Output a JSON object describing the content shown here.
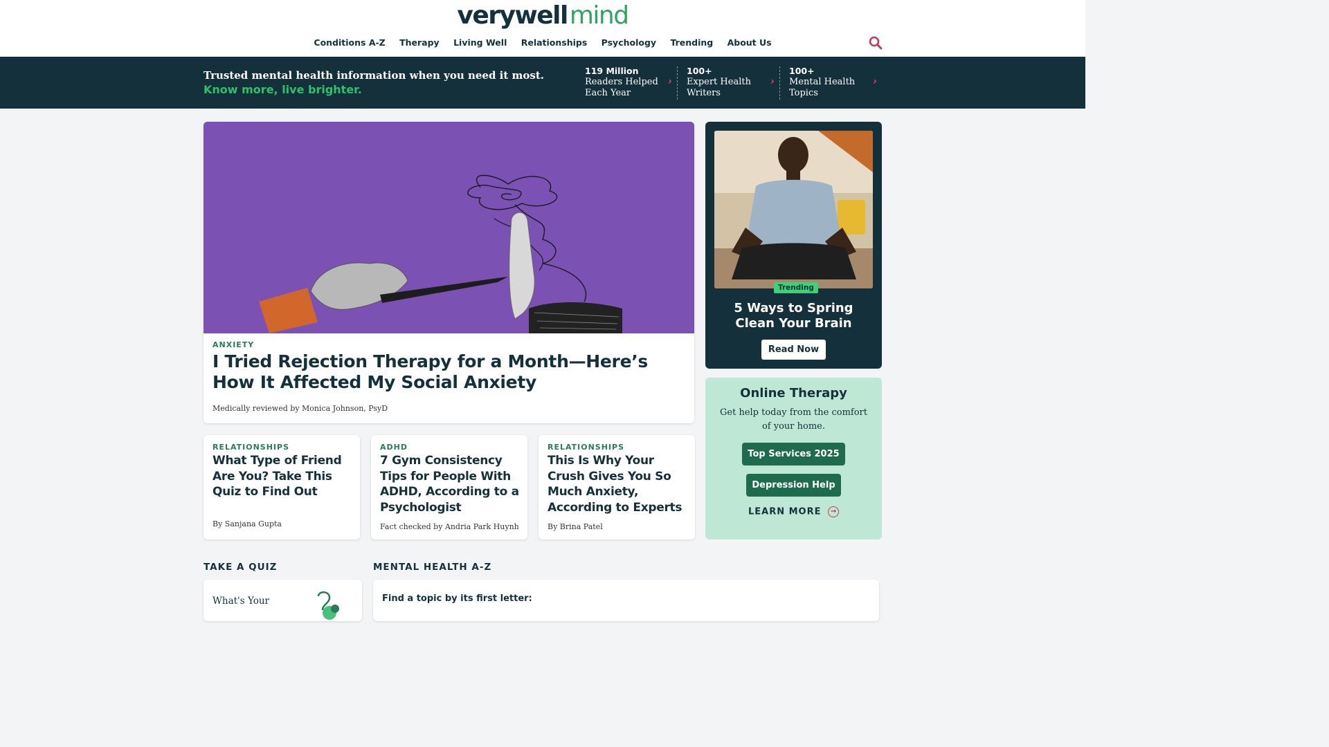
{
  "header": {
    "logo_main": "verywell",
    "logo_sub": "mind",
    "nav": [
      "Conditions A-Z",
      "Therapy",
      "Living Well",
      "Relationships",
      "Psychology",
      "Trending",
      "About Us"
    ]
  },
  "banner": {
    "line1": "Trusted mental health information when you need it most.",
    "line2": "Know more, live brighter.",
    "stats": [
      {
        "number": "119 Million",
        "line1": "Readers Helped",
        "line2": "Each Year"
      },
      {
        "number": "100+",
        "line1": "Expert Health",
        "line2": "Writers"
      },
      {
        "number": "100+",
        "line1": "Mental Health",
        "line2": "Topics"
      }
    ]
  },
  "hero": {
    "tag": "ANXIETY",
    "title": "I Tried Rejection Therapy for a Month—Here’s How It Affected My Social Anxiety",
    "byline": "Medically reviewed by Monica Johnson, PsyD"
  },
  "cards": [
    {
      "tag": "RELATIONSHIPS",
      "title": "What Type of Friend Are You? Take This Quiz to Find Out",
      "byline": "By Sanjana Gupta"
    },
    {
      "tag": "ADHD",
      "title": "7 Gym Consistency Tips for People With ADHD, According to a Psychologist",
      "byline": "Fact checked by Andria Park Huynh"
    },
    {
      "tag": "RELATIONSHIPS",
      "title": "This Is Why Your Crush Gives You So Much Anxiety, According to Experts",
      "byline": "By Brina Patel"
    }
  ],
  "trending": {
    "badge": "Trending",
    "title": "5 Ways to Spring Clean Your Brain",
    "button": "Read Now"
  },
  "therapy": {
    "title": "Online Therapy",
    "subtitle": "Get help today from the comfort of your home.",
    "button1": "Top Services 2025",
    "button2": "Depression Help",
    "learn_more": "LEARN MORE"
  },
  "quiz": {
    "heading": "TAKE A QUIZ",
    "text": "What's Your"
  },
  "az": {
    "heading": "MENTAL HEALTH A-Z",
    "text": "Find a topic by its first letter:"
  },
  "colors": {
    "navy": "#14303b",
    "green": "#2fa362",
    "purple": "#7b51b3",
    "mint": "#bfe7d5",
    "accent_red": "#c13b57"
  }
}
